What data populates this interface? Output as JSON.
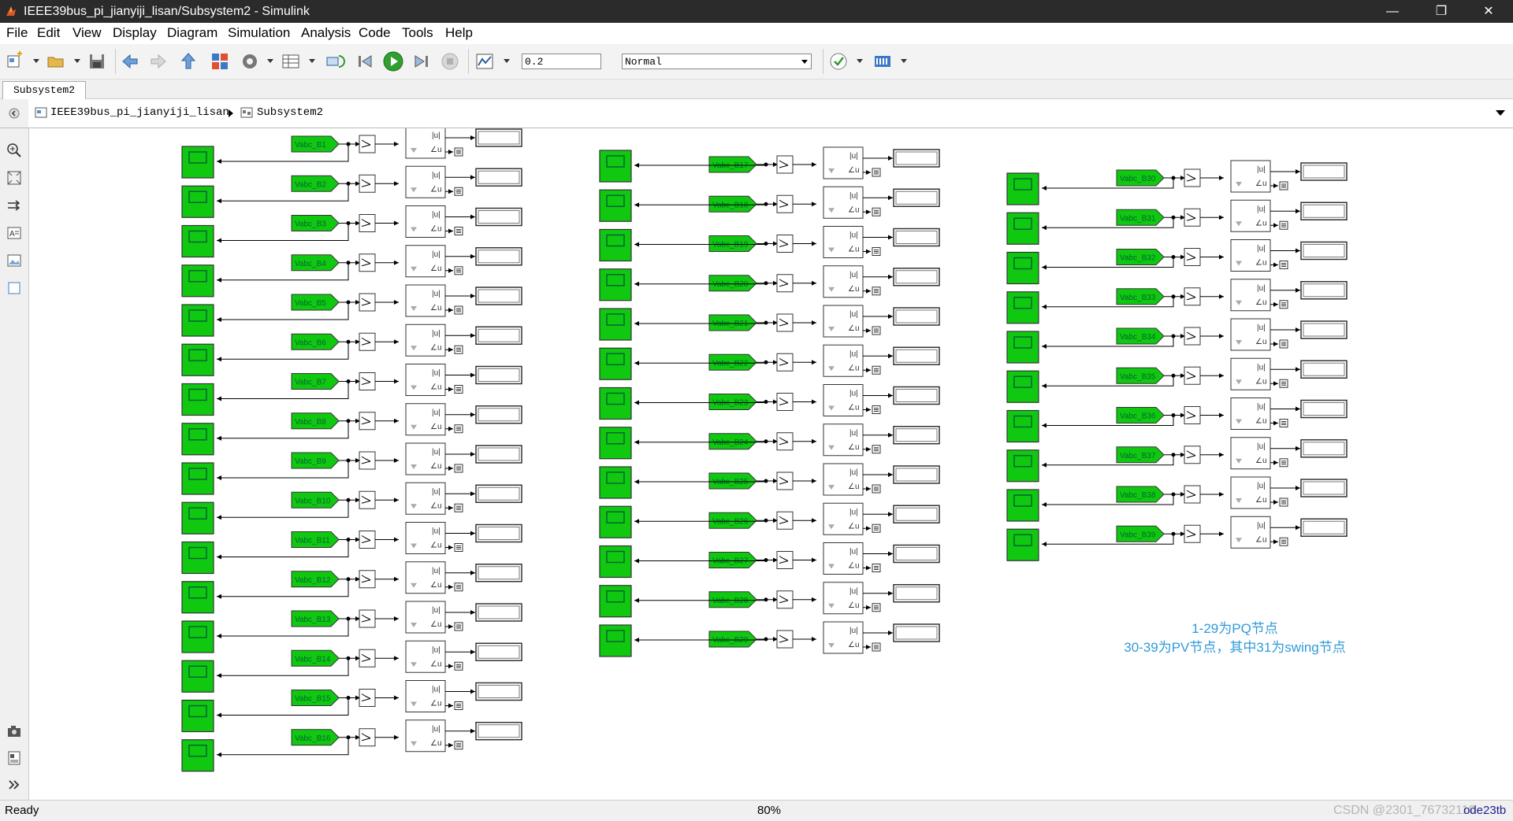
{
  "window": {
    "title": "IEEE39bus_pi_jianyiji_lisan/Subsystem2 - Simulink",
    "controls": {
      "minimize": "—",
      "restore": "❐",
      "close": "✕"
    }
  },
  "menu": [
    "File",
    "Edit",
    "View",
    "Display",
    "Diagram",
    "Simulation",
    "Analysis",
    "Code",
    "Tools",
    "Help"
  ],
  "toolbar": {
    "stop_time": "0.2",
    "sim_mode": "Normal",
    "icons": [
      "new-model-icon",
      "open-folder-icon",
      "save-icon",
      "back-icon",
      "forward-icon",
      "up-icon",
      "library-browser-icon",
      "model-config-icon",
      "model-explorer-icon",
      "update-diagram-icon",
      "step-back-icon",
      "run-icon",
      "step-forward-icon",
      "stop-icon",
      "data-inspector-icon",
      "model-advisor-icon",
      "build-icon"
    ]
  },
  "tab": {
    "label": "Subsystem2"
  },
  "breadcrumb": {
    "model": "IEEE39bus_pi_jianyiji_lisan",
    "subsystem": "Subsystem2"
  },
  "left_palette": [
    "zoom-icon",
    "fit-view-icon",
    "signal-arrow-icon",
    "annotation-icon",
    "image-icon",
    "area-icon",
    "camera-icon",
    "report-icon",
    "expand-icon"
  ],
  "diagram": {
    "columns": [
      {
        "tags": [
          "Vabc_B1",
          "Vabc_B2",
          "Vabc_B3",
          "Vabc_B4",
          "Vabc_B5",
          "Vabc_B6",
          "Vabc_B7",
          "Vabc_B8",
          "Vabc_B9",
          "Vabc_B10",
          "Vabc_B11",
          "Vabc_B12",
          "Vabc_B13",
          "Vabc_B14",
          "Vabc_B15",
          "Vabc_B16"
        ]
      },
      {
        "tags": [
          "Vabc_B17",
          "Vabc_B18",
          "Vabc_B19",
          "Vabc_B20",
          "Vabc_B21",
          "Vabc_B22",
          "Vabc_B23",
          "Vabc_B24",
          "Vabc_B25",
          "Vabc_B26",
          "Vabc_B27",
          "Vabc_B28",
          "Vabc_B29"
        ]
      },
      {
        "tags": [
          "Vabc_B30",
          "Vabc_B31",
          "Vabc_B32",
          "Vabc_B33",
          "Vabc_B34",
          "Vabc_B35",
          "Vabc_B36",
          "Vabc_B37",
          "Vabc_B38",
          "Vabc_B39"
        ]
      }
    ],
    "complex_block_labels": {
      "mag": "|u|",
      "ang": "∠u"
    },
    "block_color": "#11c811",
    "note_line1": "1-29为PQ节点",
    "note_line2": "30-39为PV节点，其中31为swing节点",
    "note_color": "#2f9ad8"
  },
  "status": {
    "left": "Ready",
    "zoom": "80%",
    "solver": "ode23tb",
    "watermark": "CSDN @2301_76732110"
  }
}
